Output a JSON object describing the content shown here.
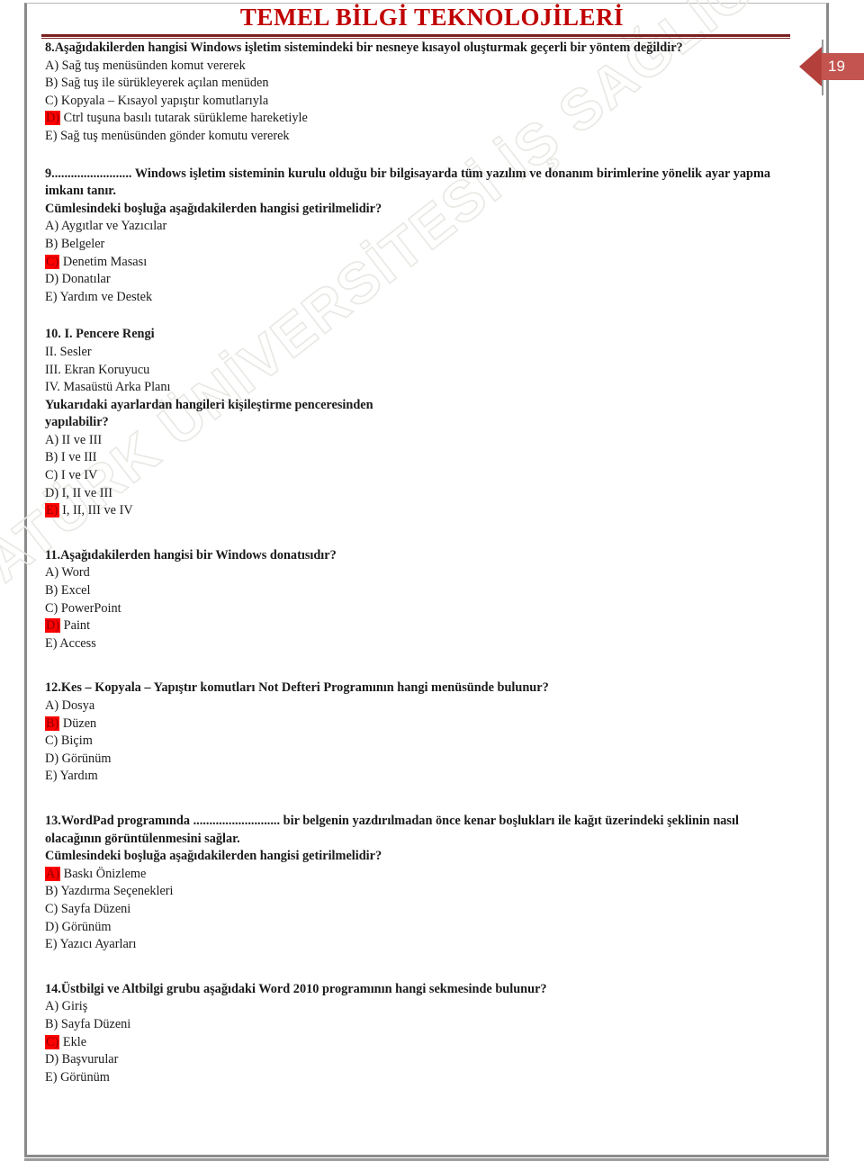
{
  "document": {
    "title": "TEMEL BİLGİ TEKNOLOJİLERİ",
    "page_number": "19",
    "watermark": "ATATÜRK ÜNİVERSİTESİ İŞ SAĞLIĞI VE GÜVENLİĞİ BÖLÜMÜ",
    "accent_title_color": "#c00000",
    "divider_color": "#7b2020",
    "badge_color": "#b4403c",
    "highlight_color": "#ff0000"
  },
  "questions": [
    {
      "number": "8.",
      "stem": "8.Aşağıdakilerden hangisi Windows işletim sistemindeki bir nesneye kısayol oluşturmak geçerli bir yöntem değildir?",
      "extra_lines": [],
      "options": [
        {
          "marker": "A)",
          "text": " Sağ tuş menüsünden komut vererek",
          "correct": false
        },
        {
          "marker": "B)",
          "text": " Sağ tuş ile sürükleyerek açılan menüden",
          "correct": false
        },
        {
          "marker": "C)",
          "text": " Kopyala – Kısayol yapıştır komutlarıyla",
          "correct": false
        },
        {
          "marker": "D)",
          "text": " Ctrl tuşuna basılı tutarak sürükleme hareketiyle",
          "correct": true
        },
        {
          "marker": "E)",
          "text": " Sağ tuş menüsünden gönder komutu vererek",
          "correct": false
        }
      ]
    },
    {
      "number": "9.",
      "stem": "9......................... Windows işletim sisteminin kurulu olduğu bir bilgisayarda tüm yazılım ve donanım birimlerine yönelik ayar yapma imkanı tanır.",
      "extra_lines": [
        {
          "text": "Cümlesindeki boşluğa aşağıdakilerden hangisi getirilmelidir?",
          "bold": true
        }
      ],
      "options": [
        {
          "marker": "A)",
          "text": " Aygıtlar ve Yazıcılar",
          "correct": false
        },
        {
          "marker": "B)",
          "text": " Belgeler",
          "correct": false
        },
        {
          "marker": "C)",
          "text": " Denetim Masası",
          "correct": true
        },
        {
          "marker": "D)",
          "text": " Donatılar",
          "correct": false
        },
        {
          "marker": "E)",
          "text": " Yardım ve Destek",
          "correct": false
        }
      ]
    },
    {
      "number": "10.",
      "stem": "10. I. Pencere Rengi",
      "extra_lines": [
        {
          "text": "II. Sesler",
          "bold": false
        },
        {
          "text": "III. Ekran Koruyucu",
          "bold": false
        },
        {
          "text": "IV. Masaüstü Arka Planı",
          "bold": false
        },
        {
          "text": "Yukarıdaki ayarlardan hangileri kişileştirme penceresinden",
          "bold": true
        },
        {
          "text": "yapılabilir?",
          "bold": true
        }
      ],
      "options": [
        {
          "marker": "A)",
          "text": " II ve III",
          "correct": false
        },
        {
          "marker": "B)",
          "text": " I ve III",
          "correct": false
        },
        {
          "marker": "C)",
          "text": " I ve IV",
          "correct": false
        },
        {
          "marker": "D)",
          "text": " I, II ve III",
          "correct": false
        },
        {
          "marker": "E)",
          "text": " I, II, III ve IV",
          "correct": true
        }
      ]
    },
    {
      "number": "11.",
      "stem": "11.Aşağıdakilerden hangisi bir Windows donatısıdır?",
      "extra_lines": [],
      "options": [
        {
          "marker": "A)",
          "text": " Word",
          "correct": false
        },
        {
          "marker": "B)",
          "text": " Excel",
          "correct": false
        },
        {
          "marker": "C)",
          "text": " PowerPoint",
          "correct": false
        },
        {
          "marker": "D)",
          "text": " Paint",
          "correct": true
        },
        {
          "marker": "E)",
          "text": " Access",
          "correct": false
        }
      ]
    },
    {
      "number": "12.",
      "stem": "12.Kes – Kopyala – Yapıştır komutları Not Defteri Programının hangi menüsünde bulunur?",
      "extra_lines": [],
      "options": [
        {
          "marker": "A)",
          "text": " Dosya",
          "correct": false
        },
        {
          "marker": "B)",
          "text": " Düzen",
          "correct": true
        },
        {
          "marker": "C)",
          "text": " Biçim",
          "correct": false
        },
        {
          "marker": "D)",
          "text": " Görünüm",
          "correct": false
        },
        {
          "marker": "E)",
          "text": " Yardım",
          "correct": false
        }
      ]
    },
    {
      "number": "13.",
      "stem": "13.WordPad programında ........................... bir belgenin yazdırılmadan önce kenar boşlukları ile kağıt üzerindeki şeklinin nasıl olacağının görüntülenmesini sağlar.",
      "extra_lines": [
        {
          "text": "Cümlesindeki boşluğa aşağıdakilerden hangisi getirilmelidir?",
          "bold": true
        }
      ],
      "options": [
        {
          "marker": "A)",
          "text": " Baskı Önizleme",
          "correct": true
        },
        {
          "marker": "B)",
          "text": " Yazdırma Seçenekleri",
          "correct": false
        },
        {
          "marker": "C)",
          "text": " Sayfa Düzeni",
          "correct": false
        },
        {
          "marker": "D)",
          "text": " Görünüm",
          "correct": false
        },
        {
          "marker": "E)",
          "text": " Yazıcı Ayarları",
          "correct": false
        }
      ]
    },
    {
      "number": "14.",
      "stem": "14.Üstbilgi ve Altbilgi grubu aşağıdaki Word 2010 programının hangi sekmesinde bulunur?",
      "extra_lines": [],
      "options": [
        {
          "marker": "A)",
          "text": " Giriş",
          "correct": false
        },
        {
          "marker": "B)",
          "text": " Sayfa Düzeni",
          "correct": false
        },
        {
          "marker": "C)",
          "text": " Ekle",
          "correct": true
        },
        {
          "marker": "D)",
          "text": " Başvurular",
          "correct": false
        },
        {
          "marker": "E)",
          "text": " Görünüm",
          "correct": false
        }
      ]
    }
  ]
}
